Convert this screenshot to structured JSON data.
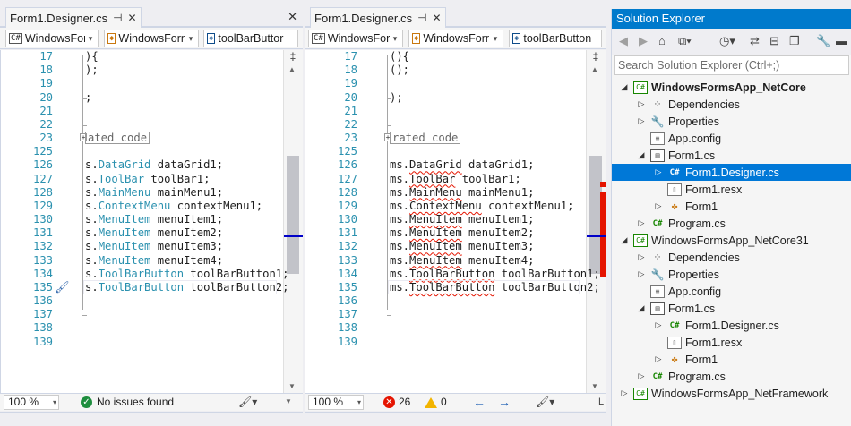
{
  "left_pane": {
    "tab_title": "Form1.Designer.cs",
    "pin_icon": "pin-icon",
    "nav": [
      "WindowsForn",
      "WindowsForn",
      "toolBarButtor"
    ],
    "zoom": "100 %",
    "status": "No issues found",
    "lines": [
      {
        "n": "17",
        "code": "){"
      },
      {
        "n": "18",
        "code": ");"
      },
      {
        "n": "19",
        "code": ""
      },
      {
        "n": "20",
        "code": ";"
      },
      {
        "n": "21",
        "code": ""
      },
      {
        "n": "22",
        "code": ""
      },
      {
        "n": "23",
        "code": "ated code"
      },
      {
        "n": "125",
        "code": ""
      },
      {
        "n": "126",
        "prefix": "s.",
        "type": "DataGrid",
        "rest": " dataGrid1;"
      },
      {
        "n": "127",
        "prefix": "s.",
        "type": "ToolBar",
        "rest": " toolBar1;"
      },
      {
        "n": "128",
        "prefix": "s.",
        "type": "MainMenu",
        "rest": " mainMenu1;"
      },
      {
        "n": "129",
        "prefix": "s.",
        "type": "ContextMenu",
        "rest": " contextMenu1;"
      },
      {
        "n": "130",
        "prefix": "s.",
        "type": "MenuItem",
        "rest": " menuItem1;"
      },
      {
        "n": "131",
        "prefix": "s.",
        "type": "MenuItem",
        "rest": " menuItem2;"
      },
      {
        "n": "132",
        "prefix": "s.",
        "type": "MenuItem",
        "rest": " menuItem3;"
      },
      {
        "n": "133",
        "prefix": "s.",
        "type": "MenuItem",
        "rest": " menuItem4;"
      },
      {
        "n": "134",
        "prefix": "s.",
        "type": "ToolBarButton",
        "rest": " toolBarButton1;"
      },
      {
        "n": "135",
        "prefix": "s.",
        "type": "ToolBarButton",
        "rest": " toolBarButton2;"
      },
      {
        "n": "136",
        "code": ""
      },
      {
        "n": "137",
        "code": ""
      },
      {
        "n": "138",
        "code": ""
      },
      {
        "n": "139",
        "code": ""
      }
    ]
  },
  "right_pane": {
    "tab_title": "Form1.Designer.cs",
    "nav": [
      "WindowsForr",
      "WindowsForr",
      "toolBarButton"
    ],
    "zoom": "100 %",
    "errors": "26",
    "warnings": "0",
    "lines": [
      {
        "n": "17",
        "code": "(){"
      },
      {
        "n": "18",
        "code": "();"
      },
      {
        "n": "19",
        "code": ""
      },
      {
        "n": "20",
        "code": ");"
      },
      {
        "n": "21",
        "code": ""
      },
      {
        "n": "22",
        "code": ""
      },
      {
        "n": "23",
        "code": "rated code"
      },
      {
        "n": "125",
        "code": ""
      },
      {
        "n": "126",
        "prefix": "ms.",
        "type": "DataGrid",
        "rest": " dataGrid1;"
      },
      {
        "n": "127",
        "prefix": "ms.",
        "type": "ToolBar",
        "rest": " toolBar1;"
      },
      {
        "n": "128",
        "prefix": "ms.",
        "type": "MainMenu",
        "rest": " mainMenu1;"
      },
      {
        "n": "129",
        "prefix": "ms.",
        "type": "ContextMenu",
        "rest": " contextMenu1;"
      },
      {
        "n": "130",
        "prefix": "ms.",
        "type": "MenuItem",
        "rest": " menuItem1;"
      },
      {
        "n": "131",
        "prefix": "ms.",
        "type": "MenuItem",
        "rest": " menuItem2;"
      },
      {
        "n": "132",
        "prefix": "ms.",
        "type": "MenuItem",
        "rest": " menuItem3;"
      },
      {
        "n": "133",
        "prefix": "ms.",
        "type": "MenuItem",
        "rest": " menuItem4;"
      },
      {
        "n": "134",
        "prefix": "ms.",
        "type": "ToolBarButton",
        "rest": " toolBarButton1;"
      },
      {
        "n": "135",
        "prefix": "ms.",
        "type": "ToolBarButton",
        "rest": " toolBarButton2;"
      },
      {
        "n": "136",
        "code": ""
      },
      {
        "n": "137",
        "code": ""
      },
      {
        "n": "138",
        "code": ""
      },
      {
        "n": "139",
        "code": ""
      }
    ]
  },
  "solution_explorer": {
    "title": "Solution Explorer",
    "search_placeholder": "Search Solution Explorer (Ctrl+;)",
    "toolbar_icons": [
      "back-icon",
      "forward-icon",
      "home-icon",
      "switch-views-icon",
      "pending-changes-icon",
      "sync-icon",
      "collapse-all-icon",
      "show-all-files-icon",
      "properties-icon"
    ],
    "tree": [
      {
        "label": "WindowsFormsApp_NetCore",
        "depth": 0,
        "arrow": "open",
        "icon": "project-icon",
        "bold": true
      },
      {
        "label": "Dependencies",
        "depth": 1,
        "arrow": "closed",
        "icon": "dependencies-icon"
      },
      {
        "label": "Properties",
        "depth": 1,
        "arrow": "closed",
        "icon": "wrench-icon"
      },
      {
        "label": "App.config",
        "depth": 1,
        "arrow": "none",
        "icon": "config-file-icon"
      },
      {
        "label": "Form1.cs",
        "depth": 1,
        "arrow": "open",
        "icon": "form-icon"
      },
      {
        "label": "Form1.Designer.cs",
        "depth": 2,
        "arrow": "closed",
        "icon": "csharp-file-icon",
        "selected": true
      },
      {
        "label": "Form1.resx",
        "depth": 2,
        "arrow": "none",
        "icon": "resx-file-icon"
      },
      {
        "label": "Form1",
        "depth": 2,
        "arrow": "closed",
        "icon": "component-icon"
      },
      {
        "label": "Program.cs",
        "depth": 1,
        "arrow": "closed",
        "icon": "csharp-file-icon"
      },
      {
        "label": "WindowsFormsApp_NetCore31",
        "depth": 0,
        "arrow": "open",
        "icon": "project-icon"
      },
      {
        "label": "Dependencies",
        "depth": 1,
        "arrow": "closed",
        "icon": "dependencies-icon"
      },
      {
        "label": "Properties",
        "depth": 1,
        "arrow": "closed",
        "icon": "wrench-icon"
      },
      {
        "label": "App.config",
        "depth": 1,
        "arrow": "none",
        "icon": "config-file-icon"
      },
      {
        "label": "Form1.cs",
        "depth": 1,
        "arrow": "open",
        "icon": "form-icon"
      },
      {
        "label": "Form1.Designer.cs",
        "depth": 2,
        "arrow": "closed",
        "icon": "csharp-file-icon"
      },
      {
        "label": "Form1.resx",
        "depth": 2,
        "arrow": "none",
        "icon": "resx-file-icon"
      },
      {
        "label": "Form1",
        "depth": 2,
        "arrow": "closed",
        "icon": "component-icon"
      },
      {
        "label": "Program.cs",
        "depth": 1,
        "arrow": "closed",
        "icon": "csharp-file-icon"
      },
      {
        "label": "WindowsFormsApp_NetFramework",
        "depth": 0,
        "arrow": "closed",
        "icon": "project-icon"
      }
    ]
  },
  "colors": {
    "accent": "#007acc",
    "selection": "#0078d7",
    "type": "#2b91af",
    "error": "#e51400",
    "ok": "#1e8e3e"
  }
}
